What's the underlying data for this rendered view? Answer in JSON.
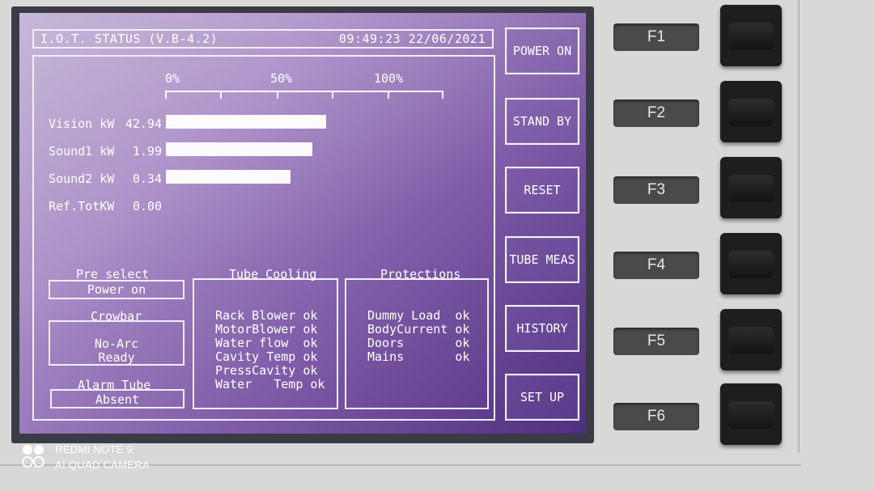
{
  "header": {
    "title": "I.O.T. STATUS (V.B-4.2)",
    "datetime": "09:49:23 22/06/2021"
  },
  "scale": {
    "labels": [
      "0%",
      "50%",
      "100%"
    ]
  },
  "meters": [
    {
      "label": "Vision kW",
      "value": "42.94",
      "level": 0.58
    },
    {
      "label": "Sound1 kW",
      "value": "1.99",
      "level": 0.53
    },
    {
      "label": "Sound2 kW",
      "value": "0.34",
      "level": 0.45
    },
    {
      "label": "Ref.TotKW",
      "value": "0.00",
      "level": 0
    }
  ],
  "pre_select": {
    "title": "Pre select",
    "value": "Power on"
  },
  "crowbar": {
    "title": "Crowbar",
    "line1": "No-Arc",
    "line2": "Ready"
  },
  "alarm_tube": {
    "title": "Alarm Tube",
    "value": "Absent"
  },
  "tube_cooling": {
    "title": "Tube Cooling",
    "items": [
      "Rack Blower ok",
      "MotorBlower ok",
      "Water flow  ok",
      "Cavity Temp ok",
      "PressCavity ok",
      "Water   Temp ok"
    ]
  },
  "protections": {
    "title": "Protections",
    "items": [
      "Dummy Load  ok",
      "BodyCurrent ok",
      "Doors       ok",
      "Mains       ok"
    ]
  },
  "soft_buttons": [
    "POWER ON",
    "STAND BY",
    "RESET",
    "TUBE MEAS",
    "HISTORY",
    "SET UP"
  ],
  "function_keys": [
    "F1",
    "F2",
    "F3",
    "F4",
    "F5",
    "F6"
  ],
  "watermark": {
    "line1": "REDMI NOTE 9",
    "line2": "AI QUAD CAMERA"
  },
  "colors": {
    "screen_top": "#b9a9cf",
    "screen_bottom": "#4f2f7f",
    "bar": "#fdfbff",
    "bezel": "#d8d8d6"
  }
}
